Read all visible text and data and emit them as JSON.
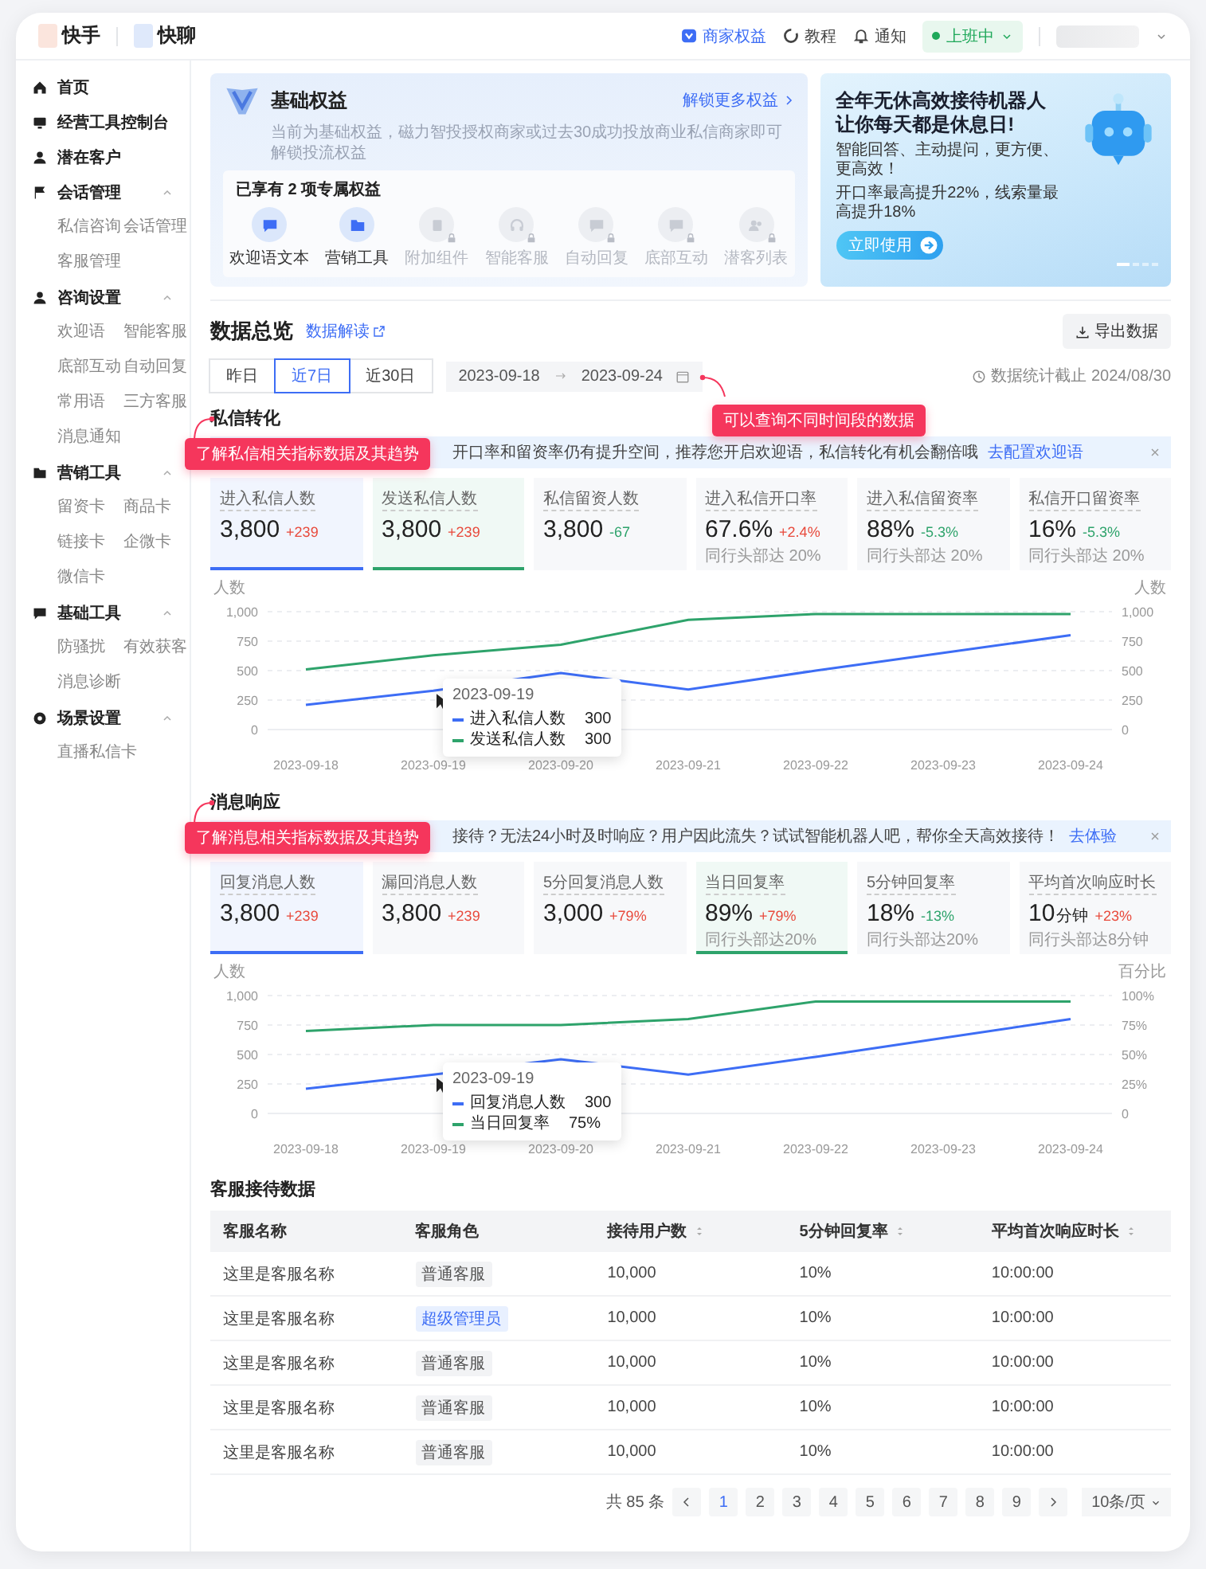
{
  "header": {
    "logo": "快手",
    "product": "快聊",
    "links": [
      {
        "label": "商家权益",
        "kind": "benefit"
      },
      {
        "label": "教程",
        "kind": "tutorial"
      },
      {
        "label": "通知",
        "kind": "notice"
      }
    ],
    "status": "上班中"
  },
  "sidebar": {
    "items": [
      {
        "label": "首页",
        "kind": "home"
      },
      {
        "label": "经营工具控制台",
        "kind": "console"
      },
      {
        "label": "潜在客户",
        "kind": "customer"
      },
      {
        "label": "会话管理",
        "kind": "session",
        "expanded": true,
        "children": [
          {
            "label": "私信咨询"
          },
          {
            "label": "会话管理"
          },
          {
            "label": "客服管理"
          }
        ]
      },
      {
        "label": "咨询设置",
        "kind": "consult",
        "expanded": true,
        "children": [
          {
            "label": "欢迎语"
          },
          {
            "label": "智能客服"
          },
          {
            "label": "底部互动"
          },
          {
            "label": "自动回复"
          },
          {
            "label": "常用语"
          },
          {
            "label": "三方客服"
          },
          {
            "label": "消息通知"
          }
        ]
      },
      {
        "label": "营销工具",
        "kind": "marketing",
        "expanded": true,
        "children": [
          {
            "label": "留资卡"
          },
          {
            "label": "商品卡"
          },
          {
            "label": "链接卡"
          },
          {
            "label": "企微卡"
          },
          {
            "label": "微信卡"
          }
        ]
      },
      {
        "label": "基础工具",
        "kind": "tools",
        "expanded": true,
        "children": [
          {
            "label": "防骚扰"
          },
          {
            "label": "有效获客"
          },
          {
            "label": "消息诊断"
          }
        ]
      },
      {
        "label": "场景设置",
        "kind": "scene",
        "expanded": true,
        "children": [
          {
            "label": "直播私信卡"
          }
        ]
      }
    ]
  },
  "benefits": {
    "title": "基础权益",
    "description": "当前为基础权益，磁力智投授权商家或过去30成功投放商业私信商家即可解锁投流权益",
    "more_link": "解锁更多权益",
    "owned_label": "已享有 2 项专属权益",
    "items": [
      {
        "label": "欢迎语文本",
        "kind": "message",
        "disabled": false
      },
      {
        "label": "营销工具",
        "kind": "folder",
        "disabled": false
      },
      {
        "label": "附加组件",
        "kind": "document",
        "disabled": true
      },
      {
        "label": "智能客服",
        "kind": "headset",
        "disabled": true
      },
      {
        "label": "自动回复",
        "kind": "chat",
        "disabled": true
      },
      {
        "label": "底部互动",
        "kind": "chat",
        "disabled": true
      },
      {
        "label": "潜客列表",
        "kind": "users",
        "disabled": true
      }
    ]
  },
  "promo": {
    "headline": [
      "全年无休高效接待机器人",
      "让你每天都是休息日!"
    ],
    "lines": [
      "智能回答、主动提问，更方便、更高效！",
      "开口率最高提升22%，线索量最高提升18%"
    ],
    "button": "立即使用",
    "slides": [
      {
        "selected": true
      },
      {
        "selected": false
      },
      {
        "selected": false
      },
      {
        "selected": false
      }
    ]
  },
  "overview": {
    "title": "数据总览",
    "link": "数据解读",
    "export_button": "导出数据",
    "ranges": [
      {
        "label": "昨日",
        "selected": false
      },
      {
        "label": "近7日",
        "selected": true
      },
      {
        "label": "近30日",
        "selected": false
      }
    ],
    "date_start": "2023-09-18",
    "date_end": "2023-09-24",
    "updated": "数据统计截止 2024/08/30",
    "hint": "可以查询不同时间段的数据"
  },
  "sections": [
    {
      "title": "私信转化",
      "hint": "了解私信相关指标数据及其趋势",
      "notice": {
        "text": "开口率和留资率仍有提升空间，推荐您开启欢迎语，私信转化有机会翻倍哦",
        "link": "去配置欢迎语"
      },
      "metrics": [
        {
          "label": "进入私信人数",
          "value": "3,800",
          "delta": "+239",
          "declining": false,
          "selected": true,
          "color": "#3d6df5"
        },
        {
          "label": "发送私信人数",
          "value": "3,800",
          "delta": "+239",
          "declining": false,
          "selected": true,
          "color": "#2ea36b"
        },
        {
          "label": "私信留资人数",
          "value": "3,800",
          "delta": "-67",
          "declining": true,
          "selected": false
        },
        {
          "label": "进入私信开口率",
          "value": "67.6%",
          "delta": "+2.4%",
          "declining": false,
          "benchmark": "同行头部达 20%",
          "selected": false
        },
        {
          "label": "进入私信留资率",
          "value": "88%",
          "delta": "-5.3%",
          "declining": true,
          "benchmark": "同行头部达 20%",
          "selected": false
        },
        {
          "label": "私信开口留资率",
          "value": "16%",
          "delta": "-5.3%",
          "declining": true,
          "benchmark": "同行头部达 20%",
          "selected": false
        }
      ],
      "chart": {
        "tooltip": {
          "date": "2023-09-19",
          "values": [
            "300",
            "300"
          ]
        },
        "chart_data": {
          "type": "line",
          "grid": true,
          "legend": true,
          "ylabel": "人数",
          "y2label": "人数",
          "categories": [
            "2023-09-18",
            "2023-09-19",
            "2023-09-20",
            "2023-09-21",
            "2023-09-22",
            "2023-09-23",
            "2023-09-24"
          ],
          "series": [
            {
              "name": "进入私信人数",
              "color": "#3d6df5",
              "values": [
                210,
                330,
                480,
                340,
                500,
                650,
                800
              ]
            },
            {
              "name": "发送私信人数",
              "color": "#2ea36b",
              "values": [
                510,
                630,
                720,
                930,
                980,
                980,
                980
              ]
            }
          ],
          "ylim": [
            0,
            1000
          ],
          "yticks": [
            0,
            250,
            500,
            750,
            {
              "value": 1000,
              "label": "1,000"
            }
          ],
          "y2lim": [
            0,
            1000
          ],
          "y2ticks": [
            0,
            250,
            500,
            750,
            {
              "value": 1000,
              "label": "1,000"
            }
          ]
        }
      }
    },
    {
      "title": "消息响应",
      "hint": "了解消息相关指标数据及其趋势",
      "notice": {
        "text": "接待？无法24小时及时响应？用户因此流失？试试智能机器人吧，帮你全天高效接待！",
        "link": "去体验"
      },
      "metrics": [
        {
          "label": "回复消息人数",
          "value": "3,800",
          "delta": "+239",
          "declining": false,
          "selected": true,
          "color": "#3d6df5"
        },
        {
          "label": "漏回消息人数",
          "value": "3,800",
          "delta": "+239",
          "declining": false,
          "selected": false
        },
        {
          "label": "5分回复消息人数",
          "value": "3,000",
          "delta": "+79%",
          "declining": false,
          "selected": false
        },
        {
          "label": "当日回复率",
          "value": "89%",
          "delta": "+79%",
          "declining": false,
          "benchmark": "同行头部达20%",
          "selected": true,
          "color": "#2ea36b"
        },
        {
          "label": "5分钟回复率",
          "value": "18%",
          "delta": "-13%",
          "declining": true,
          "benchmark": "同行头部达20%",
          "selected": false
        },
        {
          "label": "平均首次响应时长",
          "value": "10",
          "unit": "分钟",
          "delta": "+23%",
          "declining": false,
          "benchmark": "同行头部达8分钟",
          "selected": false
        }
      ],
      "chart": {
        "tooltip": {
          "date": "2023-09-19",
          "values": [
            "300",
            "75%"
          ]
        },
        "chart_data": {
          "type": "line",
          "grid": true,
          "legend": true,
          "ylabel": "人数",
          "y2label": "百分比",
          "categories": [
            "2023-09-18",
            "2023-09-19",
            "2023-09-20",
            "2023-09-21",
            "2023-09-22",
            "2023-09-23",
            "2023-09-24"
          ],
          "series": [
            {
              "name": "回复消息人数",
              "color": "#3d6df5",
              "values": [
                210,
                330,
                460,
                330,
                480,
                640,
                800
              ]
            },
            {
              "name": "当日回复率",
              "color": "#2ea36b",
              "axis": "y2",
              "values": [
                70,
                75,
                75,
                80,
                95,
                95,
                95
              ]
            }
          ],
          "ylim": [
            0,
            1000
          ],
          "yticks": [
            0,
            250,
            500,
            750,
            {
              "value": 1000,
              "label": "1,000"
            }
          ],
          "y2lim": [
            0,
            100
          ],
          "y2ticks": [
            {
              "value": 0,
              "label": "0"
            },
            {
              "value": 25,
              "label": "25%"
            },
            {
              "value": 50,
              "label": "50%"
            },
            {
              "value": 75,
              "label": "75%"
            },
            {
              "value": 100,
              "label": "100%"
            }
          ]
        }
      }
    }
  ],
  "table": {
    "title": "客服接待数据",
    "columns": [
      {
        "label": "客服名称",
        "sortable": false
      },
      {
        "label": "客服角色",
        "sortable": false
      },
      {
        "label": "接待用户数",
        "sortable": true
      },
      {
        "label": "5分钟回复率",
        "sortable": true
      },
      {
        "label": "平均首次响应时长",
        "sortable": true
      }
    ],
    "rows": [
      {
        "name": "这里是客服名称",
        "role": "普通客服",
        "admin": false,
        "users": "10,000",
        "rate": "10%",
        "response": "10:00:00"
      },
      {
        "name": "这里是客服名称",
        "role": "超级管理员",
        "admin": true,
        "users": "10,000",
        "rate": "10%",
        "response": "10:00:00"
      },
      {
        "name": "这里是客服名称",
        "role": "普通客服",
        "admin": false,
        "users": "10,000",
        "rate": "10%",
        "response": "10:00:00"
      },
      {
        "name": "这里是客服名称",
        "role": "普通客服",
        "admin": false,
        "users": "10,000",
        "rate": "10%",
        "response": "10:00:00"
      },
      {
        "name": "这里是客服名称",
        "role": "普通客服",
        "admin": false,
        "users": "10,000",
        "rate": "10%",
        "response": "10:00:00"
      }
    ],
    "pagination": {
      "total": "共 85 条",
      "pages": [
        {
          "label": "1",
          "selected": true
        },
        {
          "label": "2",
          "selected": false
        },
        {
          "label": "3",
          "selected": false
        },
        {
          "label": "4",
          "selected": false
        },
        {
          "label": "5",
          "selected": false
        },
        {
          "label": "6",
          "selected": false
        },
        {
          "label": "7",
          "selected": false
        },
        {
          "label": "8",
          "selected": false
        },
        {
          "label": "9",
          "selected": false
        }
      ],
      "page_size": "10条/页"
    }
  }
}
